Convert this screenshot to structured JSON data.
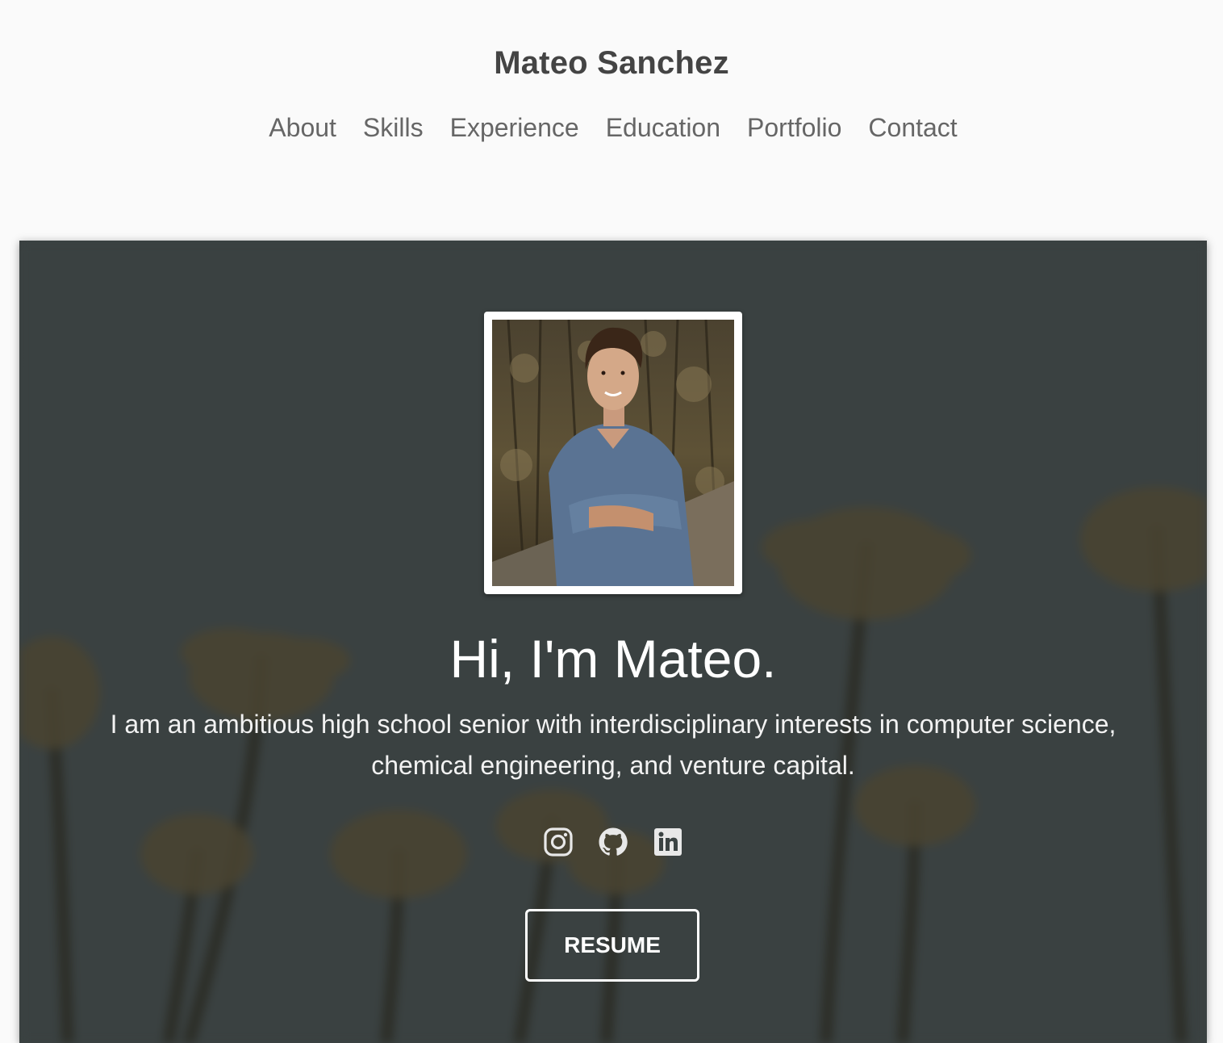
{
  "header": {
    "title": "Mateo Sanchez",
    "nav": [
      {
        "label": "About"
      },
      {
        "label": "Skills"
      },
      {
        "label": "Experience"
      },
      {
        "label": "Education"
      },
      {
        "label": "Portfolio"
      },
      {
        "label": "Contact"
      }
    ]
  },
  "hero": {
    "heading": "Hi, I'm Mateo.",
    "description": "I am an ambitious high school senior with interdisciplinary interests in computer science, chemical engineering, and venture capital.",
    "social": [
      {
        "icon": "instagram-icon"
      },
      {
        "icon": "github-icon"
      },
      {
        "icon": "linkedin-icon"
      }
    ],
    "button_label": "RESUME"
  },
  "colors": {
    "page_background": "#fafafa",
    "title_text": "#444444",
    "nav_text": "#666666",
    "hero_overlay": "#3b4343",
    "hero_text": "#ffffff"
  }
}
